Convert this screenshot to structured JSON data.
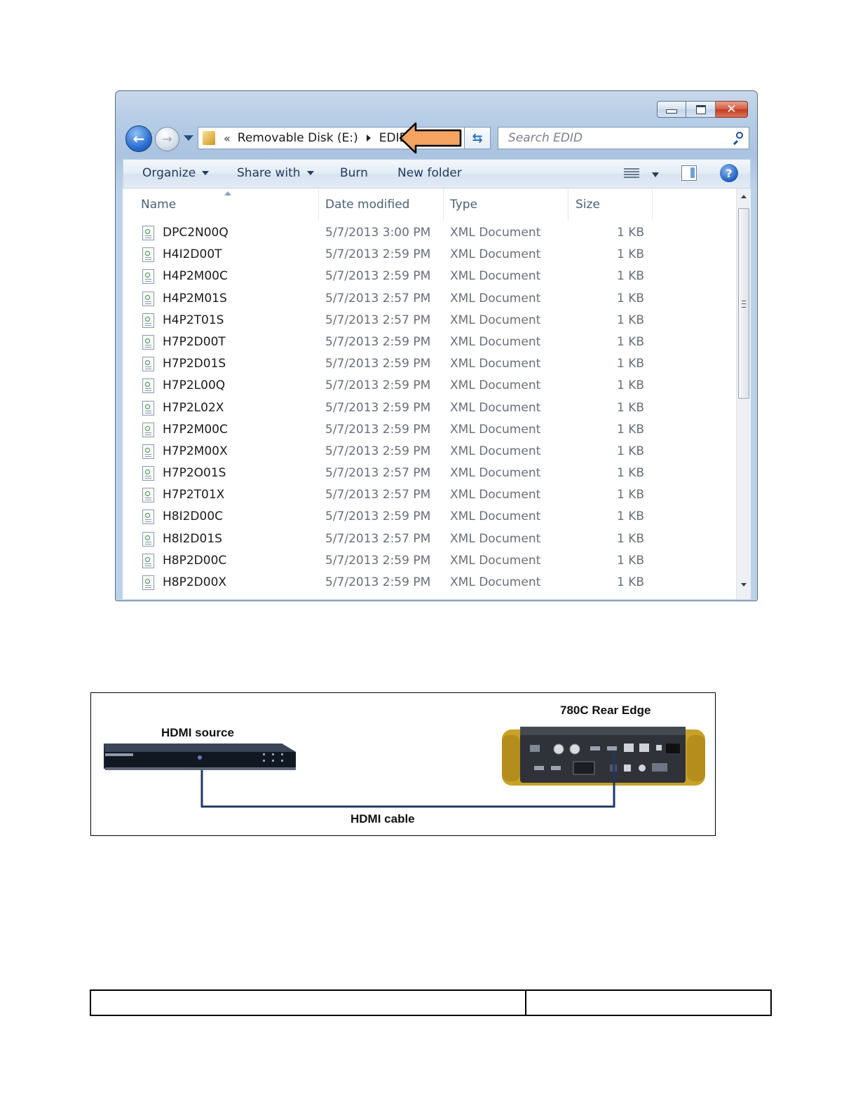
{
  "explorer": {
    "breadcrumb": {
      "prefix": "«",
      "drive": "Removable Disk (E:)",
      "folder": "EDID"
    },
    "search_placeholder": "Search EDID",
    "commands": {
      "organize": "Organize",
      "share_with": "Share with",
      "burn": "Burn",
      "new_folder": "New folder"
    },
    "columns": {
      "name": "Name",
      "date": "Date modified",
      "type": "Type",
      "size": "Size"
    },
    "files": [
      {
        "name": "DPC2N00Q",
        "date": "5/7/2013 3:00 PM",
        "type": "XML Document",
        "size": "1 KB"
      },
      {
        "name": "H4I2D00T",
        "date": "5/7/2013 2:59 PM",
        "type": "XML Document",
        "size": "1 KB"
      },
      {
        "name": "H4P2M00C",
        "date": "5/7/2013 2:59 PM",
        "type": "XML Document",
        "size": "1 KB"
      },
      {
        "name": "H4P2M01S",
        "date": "5/7/2013 2:57 PM",
        "type": "XML Document",
        "size": "1 KB"
      },
      {
        "name": "H4P2T01S",
        "date": "5/7/2013 2:57 PM",
        "type": "XML Document",
        "size": "1 KB"
      },
      {
        "name": "H7P2D00T",
        "date": "5/7/2013 2:59 PM",
        "type": "XML Document",
        "size": "1 KB"
      },
      {
        "name": "H7P2D01S",
        "date": "5/7/2013 2:59 PM",
        "type": "XML Document",
        "size": "1 KB"
      },
      {
        "name": "H7P2L00Q",
        "date": "5/7/2013 2:59 PM",
        "type": "XML Document",
        "size": "1 KB"
      },
      {
        "name": "H7P2L02X",
        "date": "5/7/2013 2:59 PM",
        "type": "XML Document",
        "size": "1 KB"
      },
      {
        "name": "H7P2M00C",
        "date": "5/7/2013 2:59 PM",
        "type": "XML Document",
        "size": "1 KB"
      },
      {
        "name": "H7P2M00X",
        "date": "5/7/2013 2:59 PM",
        "type": "XML Document",
        "size": "1 KB"
      },
      {
        "name": "H7P2O01S",
        "date": "5/7/2013 2:57 PM",
        "type": "XML Document",
        "size": "1 KB"
      },
      {
        "name": "H7P2T01X",
        "date": "5/7/2013 2:57 PM",
        "type": "XML Document",
        "size": "1 KB"
      },
      {
        "name": "H8I2D00C",
        "date": "5/7/2013 2:59 PM",
        "type": "XML Document",
        "size": "1 KB"
      },
      {
        "name": "H8I2D01S",
        "date": "5/7/2013 2:57 PM",
        "type": "XML Document",
        "size": "1 KB"
      },
      {
        "name": "H8P2D00C",
        "date": "5/7/2013 2:59 PM",
        "type": "XML Document",
        "size": "1 KB"
      },
      {
        "name": "H8P2D00X",
        "date": "5/7/2013 2:59 PM",
        "type": "XML Document",
        "size": "1 KB"
      }
    ],
    "colors": {
      "callout_arrow": "#f4a460",
      "accent": "#2a6fd1"
    }
  },
  "diagram": {
    "source_label": "HDMI source",
    "device_label": "780C Rear Edge",
    "cable_label": "HDMI cable",
    "cable_color": "#1f3864"
  }
}
